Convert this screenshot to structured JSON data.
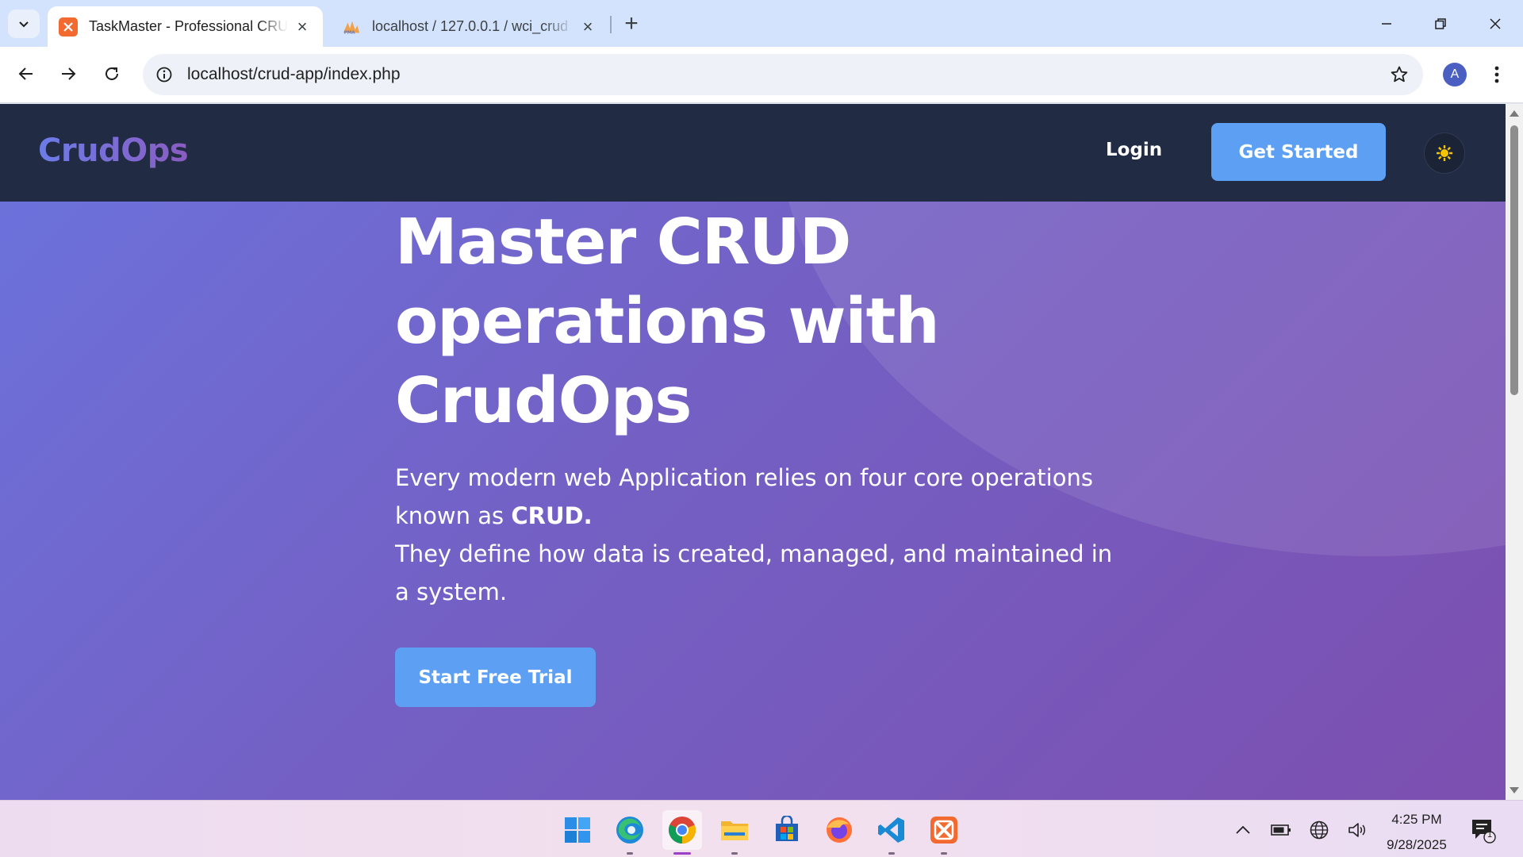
{
  "browser": {
    "tabs": [
      {
        "title": "TaskMaster - Professional CRUD",
        "active": true
      },
      {
        "title": "localhost / 127.0.0.1 / wci_crud",
        "active": false
      }
    ],
    "url": "localhost/crud-app/index.php",
    "profile_initial": "A"
  },
  "site": {
    "logo": "CrudOps",
    "nav": {
      "login": "Login",
      "get_started": "Get Started"
    },
    "hero": {
      "title": "Master CRUD operations with CrudOps",
      "text_line1": "Every modern web Application relies on four core operations known as",
      "text_bold": "CRUD.",
      "text_line2": "They define how data is created, managed, and maintained in a system.",
      "cta": "Start Free Trial"
    },
    "colors": {
      "nav_bg": "#212b43",
      "button": "#5da0f3",
      "hero_start": "#6b73dd",
      "hero_end": "#7c4fb0"
    }
  },
  "taskbar": {
    "apps": [
      "start-icon",
      "edge-icon",
      "chrome-icon",
      "file-explorer-icon",
      "store-icon",
      "firefox-icon",
      "vscode-icon",
      "xampp-icon"
    ],
    "time": "4:25 PM",
    "date": "9/28/2025",
    "notification_count": "1"
  }
}
